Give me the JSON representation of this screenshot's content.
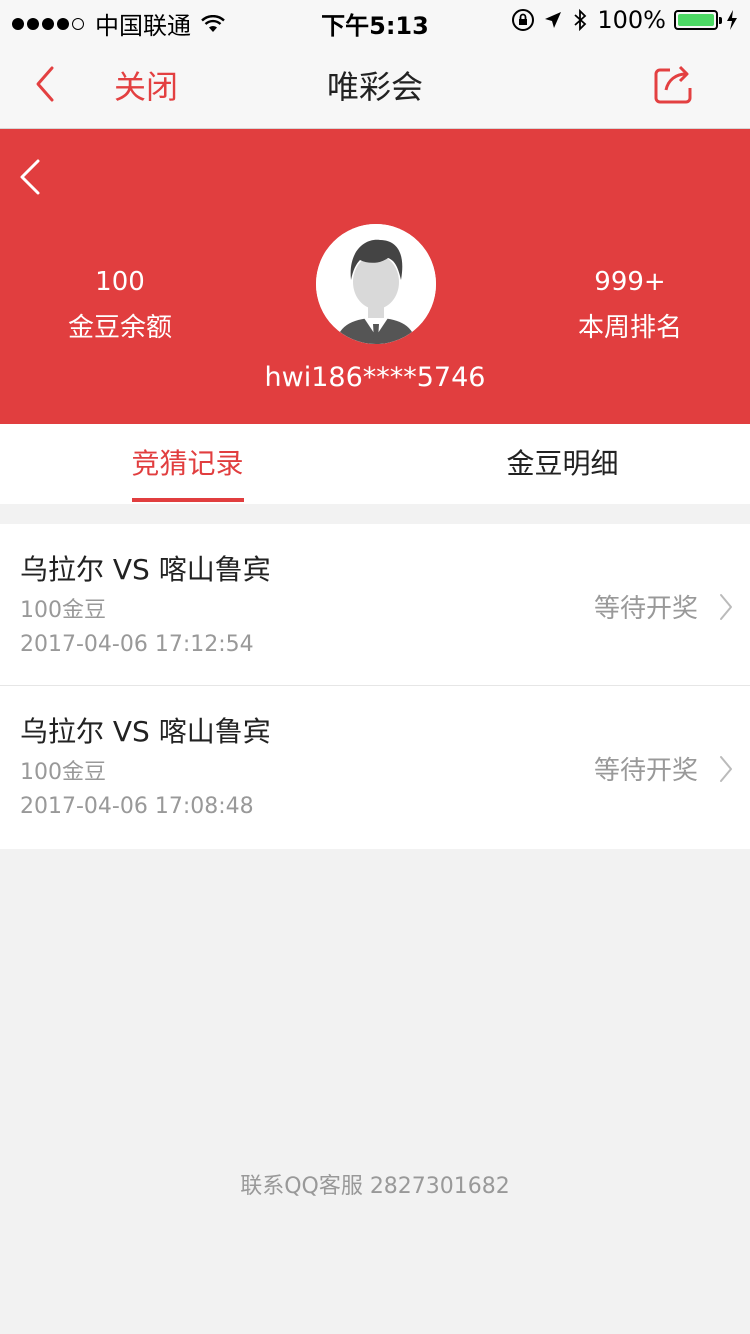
{
  "status_bar": {
    "carrier": "中国联通",
    "time": "下午5:13",
    "battery": "100%"
  },
  "nav": {
    "close_label": "关闭",
    "title": "唯彩会"
  },
  "profile": {
    "gold_balance": "100",
    "gold_balance_label": "金豆余额",
    "rank": "999+",
    "rank_label": "本周排名",
    "username": "hwi186****5746"
  },
  "tabs": [
    {
      "label": "竞猜记录"
    },
    {
      "label": "金豆明细"
    }
  ],
  "records": [
    {
      "match": "乌拉尔 VS 喀山鲁宾",
      "amount": "100金豆",
      "time": "2017-04-06 17:12:54",
      "status": "等待开奖"
    },
    {
      "match": "乌拉尔 VS 喀山鲁宾",
      "amount": "100金豆",
      "time": "2017-04-06 17:08:48",
      "status": "等待开奖"
    }
  ],
  "footer": {
    "contact": "联系QQ客服 2827301682"
  },
  "colors": {
    "accent": "#e13e3f",
    "battery": "#4cd964"
  }
}
